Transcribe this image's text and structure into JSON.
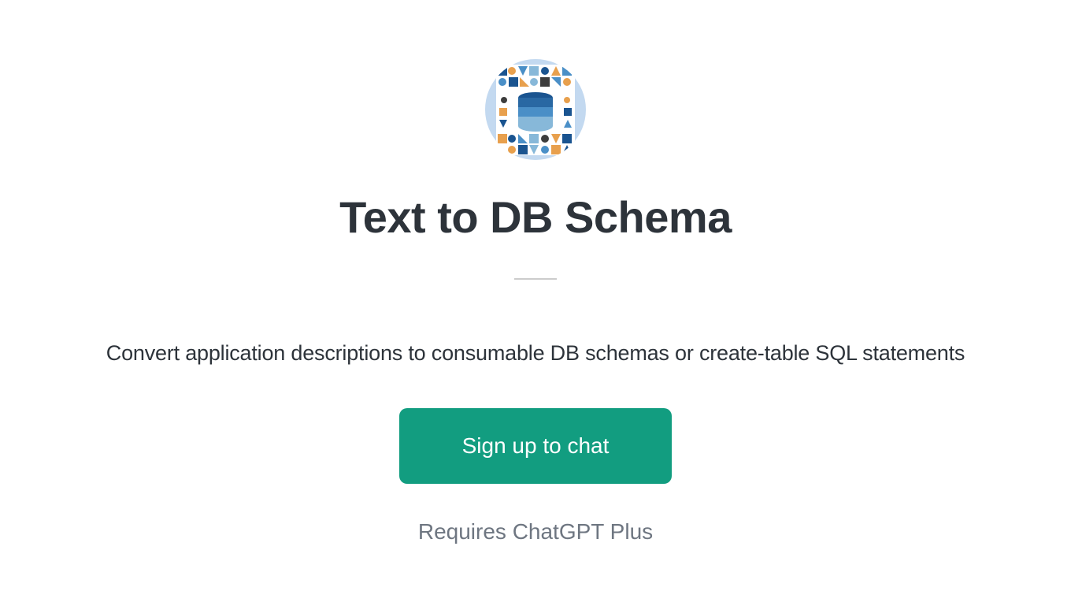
{
  "app": {
    "title": "Text to DB Schema",
    "description": "Convert application descriptions to consumable DB schemas or create-table SQL statements",
    "signup_button": "Sign up to chat",
    "requires_text": "Requires ChatGPT Plus"
  }
}
